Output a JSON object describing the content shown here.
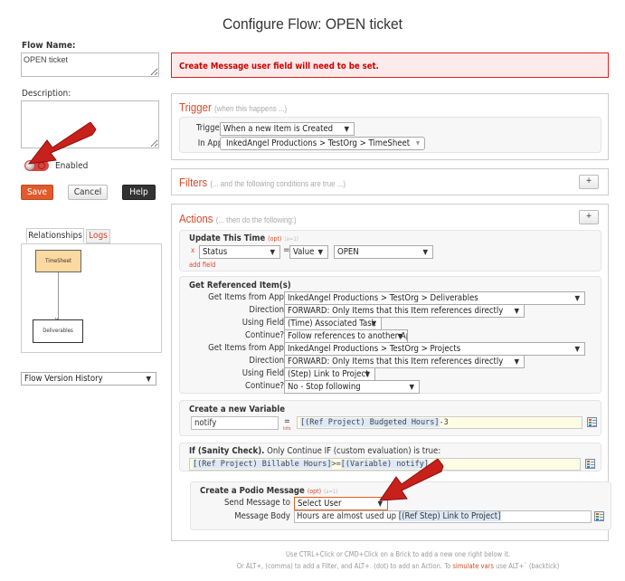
{
  "page": {
    "title": "Configure Flow: OPEN ticket"
  },
  "left": {
    "flow_name_label": "Flow Name:",
    "flow_name_value": "OPEN ticket",
    "description_label": "Description:",
    "description_value": "",
    "enabled_label": "Enabled",
    "enabled_state": "off",
    "buttons": {
      "save": "Save",
      "cancel": "Cancel",
      "help": "Help"
    },
    "tabs": [
      {
        "label": "Relationships",
        "active": true
      },
      {
        "label": "Logs",
        "active": false
      }
    ],
    "diagram": {
      "nodes": [
        "TimeSheet",
        "Deliverables"
      ]
    },
    "version_history": "Flow Version History"
  },
  "alert": {
    "message": "Create Message user field will need to be set.",
    "color": "#cc0000"
  },
  "trigger": {
    "title": "Trigger",
    "subtitle": "(when this happens ...)",
    "trigger_label": "Trigger:",
    "trigger_value": "When a new Item is Created",
    "app_label": "In App:",
    "app_value": "InkedAngel Productions > TestOrg > TimeSheet"
  },
  "filters": {
    "title": "Filters",
    "subtitle": "(... and the following conditions are true ...)",
    "add": "+"
  },
  "actions": {
    "title": "Actions",
    "subtitle": "(... then do the following:)",
    "add": "+",
    "update": {
      "title": "Update This Time",
      "opt": "(opt)",
      "count": "(a=1)",
      "remove": "x",
      "field": "Status",
      "eq": "=",
      "mode": "Value",
      "value": "OPEN",
      "add_field": "add field"
    },
    "get_ref": {
      "title": "Get Referenced Item(s)",
      "rows": [
        {
          "label": "Get Items from App",
          "value": "InkedAngel Productions > TestOrg > Deliverables"
        },
        {
          "label": "Direction",
          "value": "FORWARD: Only Items that this Item references directly"
        },
        {
          "label": "Using Field",
          "value": "(Time) Associated Task"
        },
        {
          "label": "Continue?",
          "value": "Follow references to another App"
        },
        {
          "label": "Get Items from App",
          "value": "InkedAngel Productions > TestOrg > Projects"
        },
        {
          "label": "Direction",
          "value": "FORWARD: Only Items that this Item references directly"
        },
        {
          "label": "Using Field",
          "value": "(Step) Link to Project"
        },
        {
          "label": "Continue?",
          "value": "No - Stop following"
        }
      ]
    },
    "variable": {
      "title": "Create a new Variable",
      "name": "notify",
      "eq": "=",
      "info": "Info",
      "expr_token": "[(Ref Project) Budgeted Hours]",
      "expr_rest": "-3"
    },
    "ifcheck": {
      "title_bold": "If (Sanity Check).",
      "title_rest": "Only Continue IF (custom evaluation) is true:",
      "token1": "[(Ref Project) Billable Hours]",
      "op": ">=",
      "token2": "[(Variable) notify]"
    },
    "message": {
      "title": "Create a Podio Message",
      "opt": "(opt)",
      "count": "(a=1)",
      "to_label": "Send Message to",
      "to_value": "Select User",
      "body_label": "Message Body",
      "body_text": "Hours are almost used up ",
      "body_token": "[(Ref Step) Link to Project]"
    }
  },
  "footer": {
    "line1": "Use CTRL+Click or CMD+Click on a Brick to add a new one right below it.",
    "line2_pre": "Or ALT+, (comma) to add a Filter, and ALT+. (dot) to add an Action. To ",
    "line2_link": "simulate vars",
    "line2_post": " use ALT+` (backtick)"
  },
  "colors": {
    "accent": "#d84a28",
    "save": "#e05a2b",
    "help": "#333333",
    "arrow": "#c8201a",
    "node": "#fcd9a0"
  }
}
